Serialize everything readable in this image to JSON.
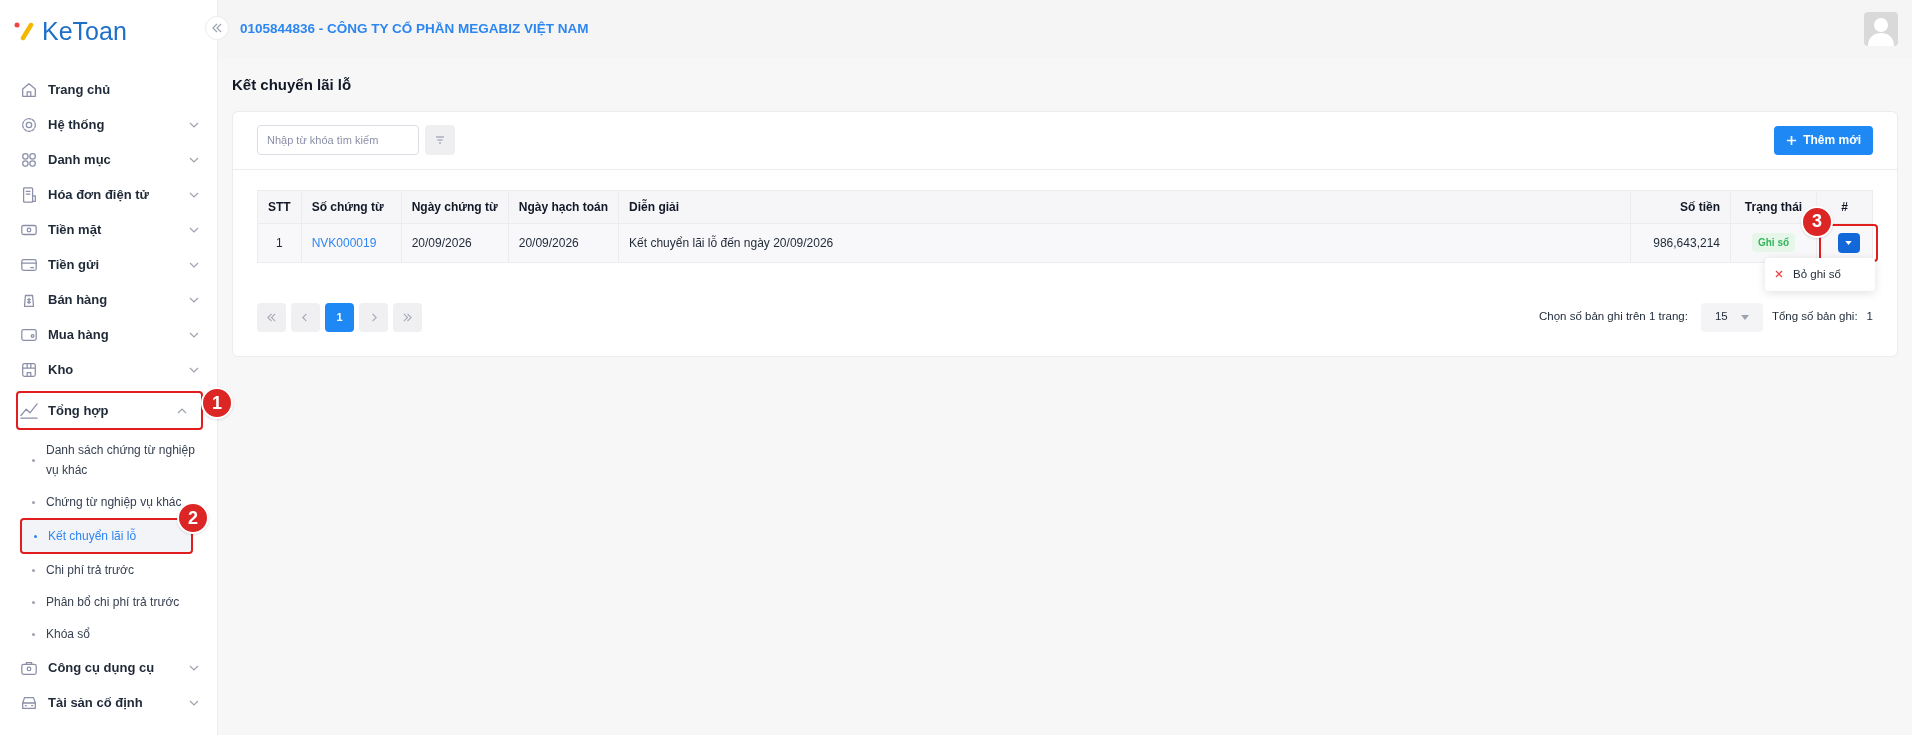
{
  "logo": {
    "text": "KeToan"
  },
  "header": {
    "company": "0105844836 - CÔNG TY CỔ PHẦN MEGABIZ VIỆT NAM"
  },
  "sidebar": {
    "items": [
      {
        "label": "Trang chủ",
        "kind": "link"
      },
      {
        "label": "Hệ thống",
        "kind": "group",
        "expanded": false
      },
      {
        "label": "Danh mục",
        "kind": "group",
        "expanded": false
      },
      {
        "label": "Hóa đơn điện tử",
        "kind": "group",
        "expanded": false
      },
      {
        "label": "Tiền mặt",
        "kind": "group",
        "expanded": false
      },
      {
        "label": "Tiền gửi",
        "kind": "group",
        "expanded": false
      },
      {
        "label": "Bán hàng",
        "kind": "group",
        "expanded": false
      },
      {
        "label": "Mua hàng",
        "kind": "group",
        "expanded": false
      },
      {
        "label": "Kho",
        "kind": "group",
        "expanded": false
      },
      {
        "label": "Tổng hợp",
        "kind": "group",
        "expanded": true,
        "children": [
          {
            "label": "Danh sách chứng từ nghiệp vụ khác",
            "selected": false
          },
          {
            "label": "Chứng từ nghiệp vụ khác",
            "selected": false
          },
          {
            "label": "Kết chuyển lãi lỗ",
            "selected": true
          },
          {
            "label": "Chi phí trả trước",
            "selected": false
          },
          {
            "label": "Phân bổ chi phí trả trước",
            "selected": false
          },
          {
            "label": "Khóa sổ",
            "selected": false
          }
        ]
      },
      {
        "label": "Công cụ dụng cụ",
        "kind": "group",
        "expanded": false
      },
      {
        "label": "Tài sản cố định",
        "kind": "group",
        "expanded": false
      }
    ]
  },
  "page_title": "Kết chuyển lãi lỗ",
  "search": {
    "placeholder": "Nhập từ khóa tìm kiếm"
  },
  "add_button": "Thêm mới",
  "table": {
    "columns": [
      "STT",
      "Số chứng từ",
      "Ngày chứng từ",
      "Ngày hạch toán",
      "Diễn giải",
      "Số tiền",
      "Trạng thái",
      "#"
    ],
    "rows": [
      {
        "stt": "1",
        "number": "NVK000019",
        "doc_date": "20/09/2026",
        "post_date": "20/09/2026",
        "description": "Kết chuyển lãi lỗ đến ngày 20/09/2026",
        "amount": "986,643,214",
        "status": "Ghi sổ"
      }
    ]
  },
  "row_menu": {
    "items": [
      "Bỏ ghi sổ"
    ]
  },
  "pagination": {
    "pages": [
      {
        "label": "1",
        "selected": true
      }
    ],
    "page_size_label": "Chọn số bản ghi trên 1 trang:",
    "page_size": "15",
    "total_label": "Tổng số bản ghi:",
    "total": "1"
  },
  "annotations": [
    "1",
    "2",
    "3"
  ]
}
